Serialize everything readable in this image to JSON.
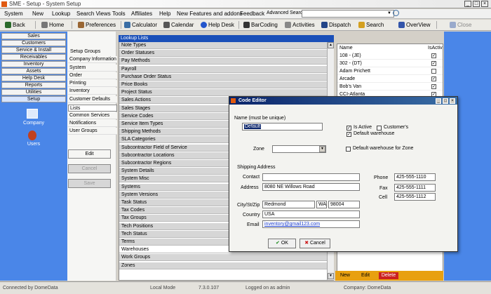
{
  "window": {
    "title": "SME - Setup - System Setup"
  },
  "menu": {
    "items": [
      "System",
      "New",
      "Lookup",
      "Search Views",
      "Tools",
      "Affiliates",
      "Help",
      "New Features and addons",
      "Feedback"
    ],
    "advanced_search_label": "Advanced Search"
  },
  "toolbar": {
    "items": [
      "Back",
      "Home",
      "Preferences",
      "Calculator",
      "Calendar",
      "Help Desk",
      "BarCoding",
      "Activities",
      "Dispatch",
      "Search",
      "OverView",
      "Close"
    ]
  },
  "nav": {
    "buttons": [
      "Sales",
      "Customers",
      "Service & Install",
      "Receivables",
      "Inventory",
      "Assets",
      "Help Desk",
      "Reports",
      "Utilities",
      "Setup"
    ],
    "active": "Setup",
    "icon_items": [
      "Company",
      "Users"
    ]
  },
  "setup": {
    "caption": "Setup Groups",
    "groups": [
      "Company Information",
      "System",
      "Order",
      "Printing",
      "Inventory",
      "Customer Defaults",
      "Lists",
      "Common Services",
      "Notifications",
      "User Groups"
    ],
    "selected": "Lists",
    "edit_label": "Edit",
    "cancel_label": "Cancel",
    "save_label": "Save"
  },
  "lookup": {
    "header": "Lookup Lists",
    "items": [
      "Note Types",
      "Order Statuses",
      "Pay Methods",
      "Payroll",
      "Purchase Order Status",
      "Price Books",
      "Project Status",
      "Sales Actions",
      "Sales Stages",
      "Service Codes",
      "Service Item Types",
      "Shipping Methods",
      "SLA Categories",
      "Subcontractor Field of Service",
      "Subcontractor Locations",
      "Subcontractor Regions",
      "System Details",
      "System Misc",
      "Systems",
      "System Versions",
      "Task Status",
      "Tax Codes",
      "Tax Groups",
      "Tech Positions",
      "Tech Status",
      "Terms",
      "Warehouses",
      "Work Groups",
      "Zones"
    ],
    "selected": "Warehouses"
  },
  "grid": {
    "col_name": "Name",
    "col_active": "IsActiv",
    "rows": [
      {
        "name": "108 - (JE)",
        "active": true
      },
      {
        "name": "302 - (DT)",
        "active": true
      },
      {
        "name": "Adam Prichett",
        "active": false
      },
      {
        "name": "Arcade",
        "active": true
      },
      {
        "name": "Bob's Van",
        "active": true
      },
      {
        "name": "CCI-Atlanta",
        "active": true
      }
    ],
    "new_label": "New",
    "edit_label": "Edit",
    "delete_label": "Delete"
  },
  "dialog": {
    "title": "Code Editor",
    "name_label": "Name (must be unique)",
    "name_value": "Default",
    "is_active_label": "Is Active",
    "customers_label": "Customer's",
    "default_warehouse_label": "Default warehouse",
    "zone_label": "Zone",
    "zone_value": "",
    "default_zone_label": "Default warehouse for Zone",
    "shipping_label": "Shipping Address",
    "contact_label": "Contact",
    "contact_value": "",
    "address_label": "Address",
    "address_value": "8080 NE Willows Road",
    "csz_label": "City/St/Zip",
    "city_value": "Redmond",
    "state_value": "WA",
    "zip_value": "98004",
    "country_label": "Country",
    "country_value": "USA",
    "email_label": "Email",
    "email_value": "inventory@gmail123.com",
    "phone_label": "Phone",
    "phone_value": "425-555-1110",
    "fax_label": "Fax",
    "fax_value": "425-555-1111",
    "cell_label": "Cell",
    "cell_value": "425-555-1112",
    "ok_label": "OK",
    "cancel_label": "Cancel"
  },
  "status": {
    "left": "Connected by DomeData",
    "mode": "Local Mode",
    "version": "7.3.0.107",
    "user": "Logged on as admin",
    "company": "Company: DomeData"
  },
  "colors": {
    "nav_blue": "#4a86e8",
    "header_blue": "#1a4fb8",
    "grid_bar": "#e8a010"
  }
}
